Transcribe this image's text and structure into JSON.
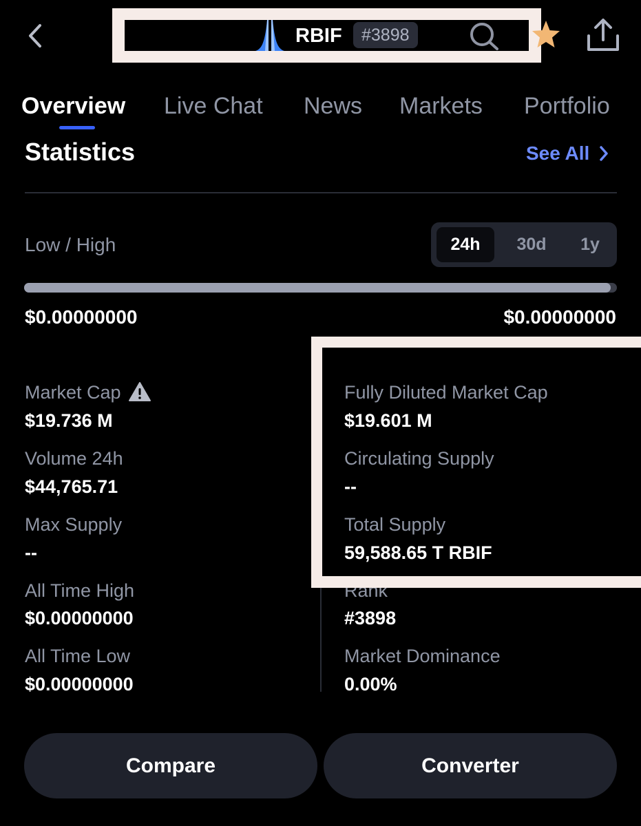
{
  "header": {
    "coin_symbol": "RBIF",
    "coin_rank_badge": "#3898"
  },
  "tabs": [
    {
      "label": "Overview",
      "active": true
    },
    {
      "label": "Live Chat",
      "active": false
    },
    {
      "label": "News",
      "active": false
    },
    {
      "label": "Markets",
      "active": false
    },
    {
      "label": "Portfolio",
      "active": false
    }
  ],
  "statistics": {
    "title": "Statistics",
    "see_all": "See All",
    "low_high_label": "Low / High",
    "periods": [
      {
        "label": "24h",
        "selected": true
      },
      {
        "label": "30d",
        "selected": false
      },
      {
        "label": "1y",
        "selected": false
      }
    ],
    "range_position": 0.99,
    "low": "$0.00000000",
    "high": "$0.00000000"
  },
  "stats_left": [
    {
      "label": "Market Cap",
      "value": "$19.736 M"
    },
    {
      "label": "Volume 24h",
      "value": "$44,765.71"
    },
    {
      "label": "Max Supply",
      "value": "--"
    },
    {
      "label": "All Time High",
      "value": "$0.00000000"
    },
    {
      "label": "All Time Low",
      "value": "$0.00000000"
    }
  ],
  "stats_right": [
    {
      "label": "Fully Diluted Market Cap",
      "value": "$19.601 M"
    },
    {
      "label": "Circulating Supply",
      "value": "--"
    },
    {
      "label": "Total Supply",
      "value": "59,588.65 T RBIF"
    },
    {
      "label": "Rank",
      "value": "#3898"
    },
    {
      "label": "Market Dominance",
      "value": "0.00%"
    }
  ],
  "buttons": {
    "compare": "Compare",
    "converter": "Converter"
  },
  "colors": {
    "accent": "#3861fb",
    "link": "#6d8bff",
    "star": "#f2b774",
    "logo": "#3b82f6"
  }
}
